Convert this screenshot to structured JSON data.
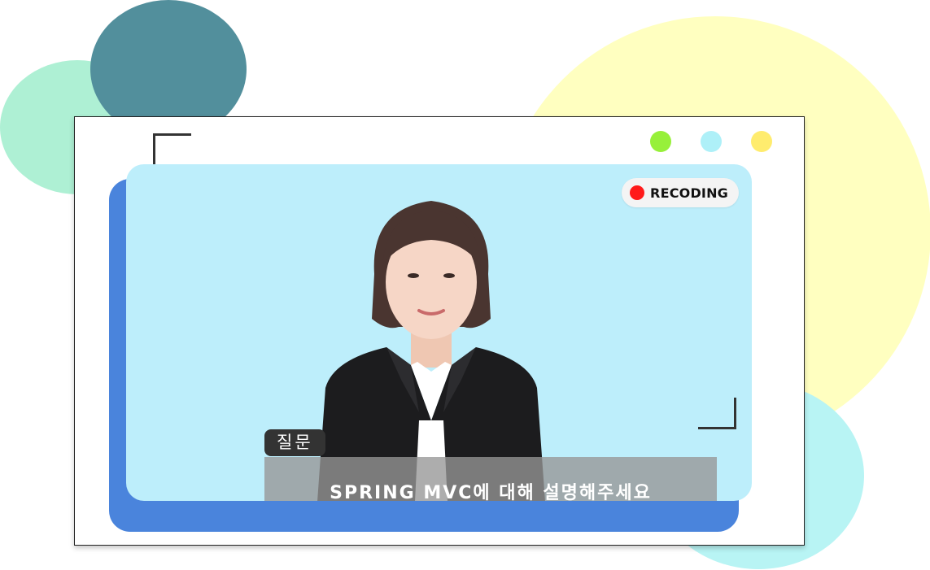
{
  "colors": {
    "blob_mint": "#aef0d4",
    "blob_teal": "#528f9c",
    "blob_yellow": "#ffffc0",
    "blob_cyan": "#b8f4f4",
    "back_panel": "#4a84dc",
    "video_bg": "#bdeefb",
    "dot_green": "#97f03a",
    "dot_cyan": "#aef0f8",
    "dot_yellow": "#ffec6e",
    "rec_dot": "#ff1a1a"
  },
  "window_controls": {
    "icons": [
      "green-dot-icon",
      "cyan-dot-icon",
      "yellow-dot-icon"
    ]
  },
  "recording": {
    "label": "RECODING"
  },
  "question": {
    "tag_label": "질문",
    "text": "SPRING MVC에 대해 설명해주세요"
  }
}
